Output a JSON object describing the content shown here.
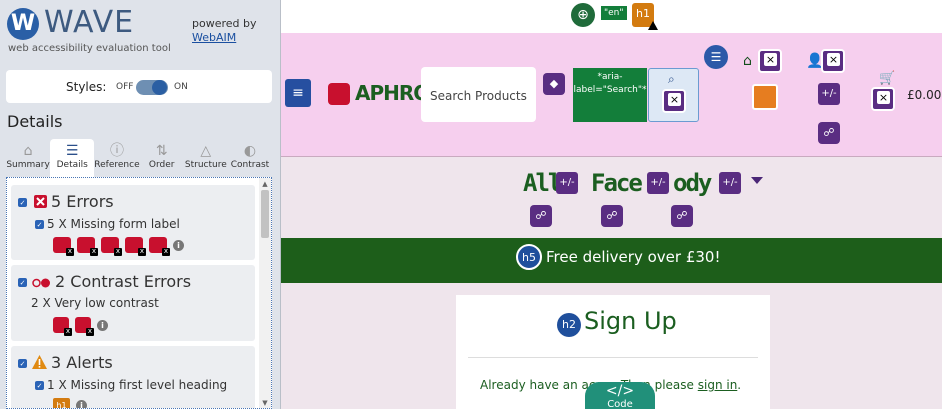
{
  "wave": {
    "logo_letter": "W",
    "title": "WAVE",
    "subtitle": "web accessibility evaluation tool",
    "powered_by": "powered by",
    "webaim": "WebAIM",
    "styles_label": "Styles:",
    "styles_off": "OFF",
    "styles_on": "ON",
    "details_heading": "Details",
    "tabs": [
      {
        "label": "Summary",
        "icon": "home-icon"
      },
      {
        "label": "Details",
        "icon": "list-icon"
      },
      {
        "label": "Reference",
        "icon": "info-icon"
      },
      {
        "label": "Order",
        "icon": "order-icon"
      },
      {
        "label": "Structure",
        "icon": "structure-icon"
      },
      {
        "label": "Contrast",
        "icon": "contrast-icon"
      }
    ],
    "categories": [
      {
        "title": "5 Errors",
        "sub": "5 X Missing form label"
      },
      {
        "title": "2 Contrast Errors",
        "sub": "2 X Very low contrast"
      },
      {
        "title": "3 Alerts",
        "sub": "1 X Missing first level heading"
      }
    ],
    "h1_badge": "h1"
  },
  "site": {
    "lang_tag": "\"en\"",
    "h1_badge": "h1",
    "brand": "APHROS",
    "search_placeholder": "Search Products",
    "aria_label": "*aria-label=\"Search\"*",
    "price": "£0.00",
    "nav_all": "All",
    "nav_face": "Face",
    "nav_body": "ody",
    "pm_label": "+/-",
    "banner_badge": "h5",
    "banner_text": "Free delivery over £30!",
    "card_badge": "h2",
    "card_title": "Sign Up",
    "card_text_pre": "Already have an accou",
    "card_text_mid": "Then please",
    "card_link": "sign in",
    "code_glyph": "</>",
    "code_label": "Code"
  },
  "colors": {
    "wave_bg": "#dfe3ea",
    "header_pink": "#f6cfee",
    "brand_green": "#1b5e20",
    "banner_green": "#1d5e1a",
    "error_red": "#c8102e",
    "wave_purple": "#5a2d82"
  }
}
